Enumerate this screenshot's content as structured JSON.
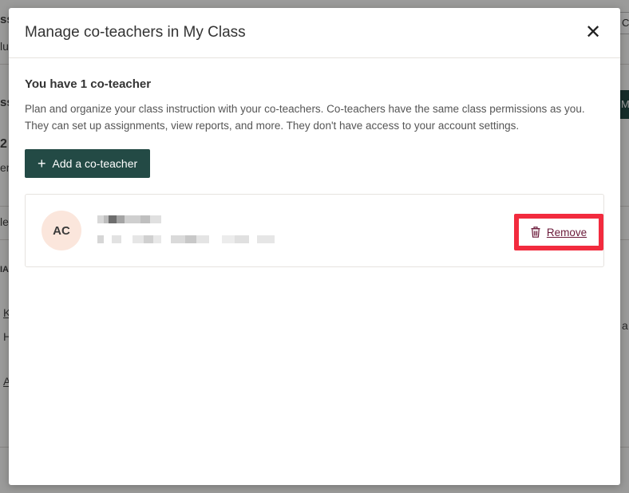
{
  "background": {
    "fragments": [
      "ss",
      "lu",
      "ss",
      "2",
      "er",
      "le",
      "IA",
      "K",
      "H",
      "A",
      "a",
      "M",
      "C"
    ]
  },
  "modal": {
    "title": "Manage co-teachers in My Class",
    "close_icon": "close-icon",
    "heading": "You have 1 co-teacher",
    "description": "Plan and organize your class instruction with your co-teachers. Co-teachers have the same class permissions as you. They can set up assignments, view reports, and more. They don't have access to your account settings.",
    "add_button": {
      "icon": "plus-icon",
      "label": "Add a co-teacher"
    },
    "coteachers": [
      {
        "initials": "AC",
        "remove_label": "Remove",
        "remove_icon": "trash-icon"
      }
    ]
  },
  "colors": {
    "primary": "#234a45",
    "highlight": "#f22b3e",
    "avatar_bg": "#fbe6dc",
    "remove_text": "#6b1a3a"
  }
}
